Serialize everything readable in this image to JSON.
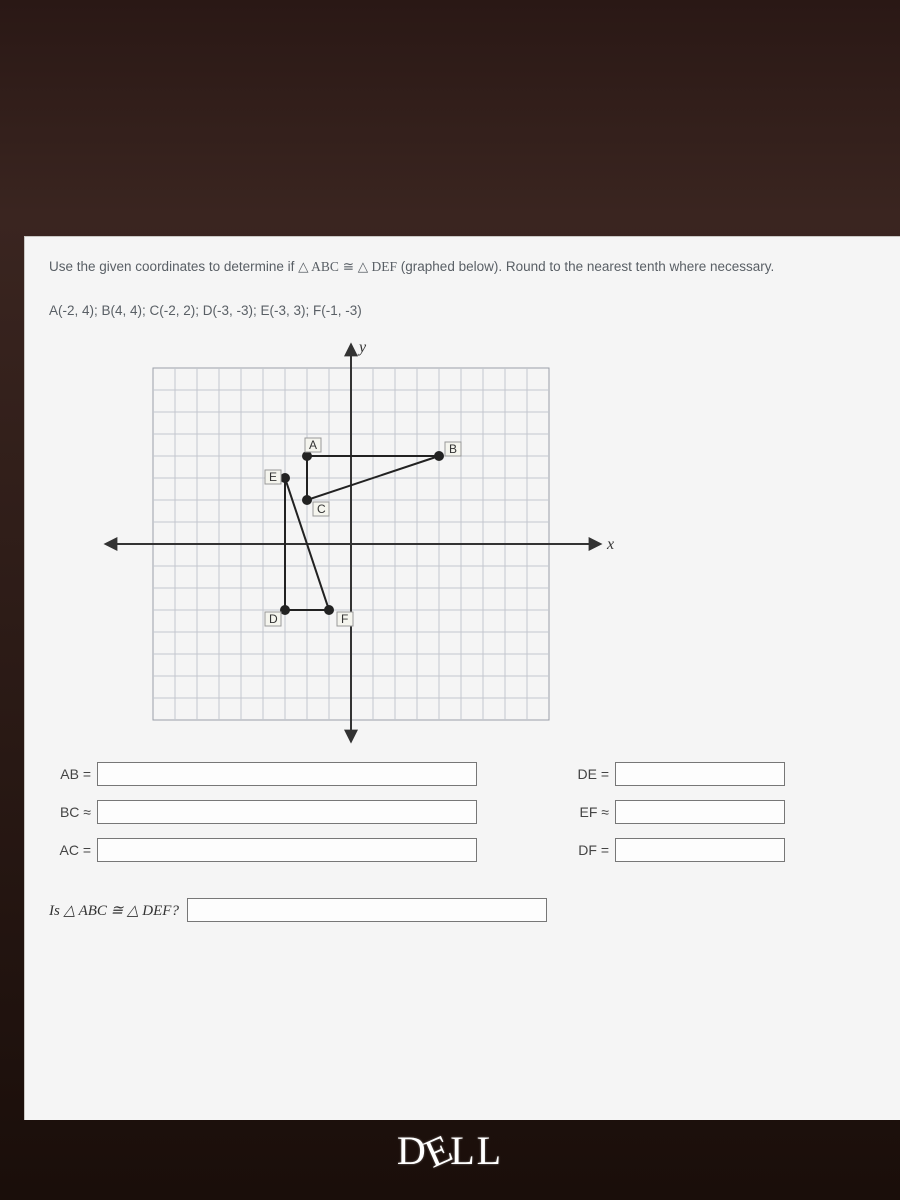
{
  "problem": {
    "prompt_prefix": "Use the given coordinates to determine if ",
    "tri1": "△ ABC",
    "cong": " ≅ ",
    "tri2": "△ DEF",
    "prompt_suffix": " (graphed below). Round to the nearest tenth where necessary.",
    "coordinates_line": "A(-2, 4); B(4, 4); C(-2, 2); D(-3, -3); E(-3, 3); F(-1, -3)"
  },
  "graph": {
    "x_label": "x",
    "y_label": "y",
    "points": {
      "A": {
        "x": -2,
        "y": 4,
        "label": "A"
      },
      "B": {
        "x": 4,
        "y": 4,
        "label": "B"
      },
      "C": {
        "x": -2,
        "y": 2,
        "label": "C"
      },
      "D": {
        "x": -3,
        "y": -3,
        "label": "D"
      },
      "E": {
        "x": -3,
        "y": 3,
        "label": "E"
      },
      "F": {
        "x": -1,
        "y": -3,
        "label": "F"
      }
    }
  },
  "answers": {
    "left": [
      {
        "label": "AB =",
        "value": ""
      },
      {
        "label": "BC ≈",
        "value": ""
      },
      {
        "label": "AC =",
        "value": ""
      }
    ],
    "right": [
      {
        "label": "DE =",
        "value": ""
      },
      {
        "label": "EF ≈",
        "value": ""
      },
      {
        "label": "DF =",
        "value": ""
      }
    ],
    "final_question": "Is △ ABC ≅ △ DEF?",
    "final_value": ""
  },
  "brand": "DELL"
}
